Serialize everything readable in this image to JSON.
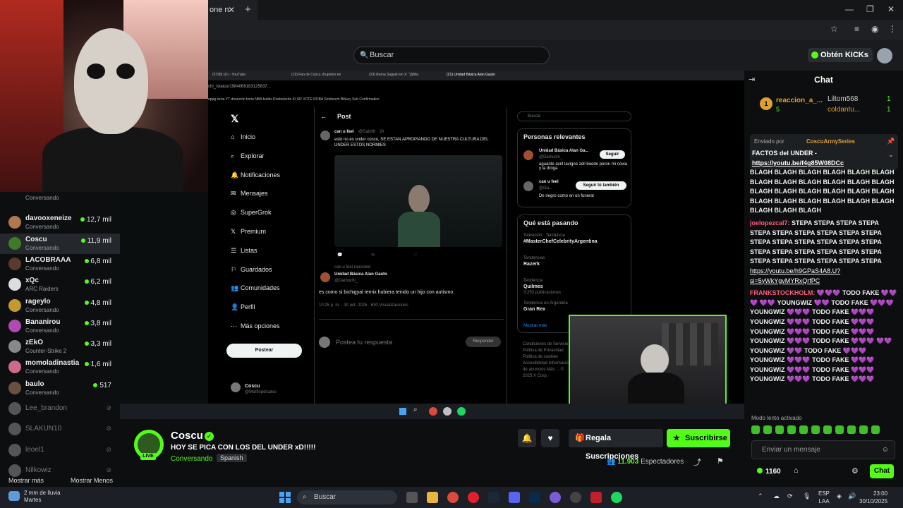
{
  "browser": {
    "tab_label": "one n",
    "close_glyph": "✕",
    "new_tab_glyph": "+"
  },
  "kick_header": {
    "search_placeholder": "Buscar",
    "kicks_button": "Obtén KICKs"
  },
  "sidebar": {
    "items": [
      {
        "name": "",
        "sub": "Conversando",
        "count": "",
        "live": false
      },
      {
        "name": "davooxeneize",
        "sub": "Conversando",
        "count": "12,7 mil",
        "live": true,
        "color": "#b07850"
      },
      {
        "name": "Coscu",
        "sub": "Conversando",
        "count": "11,9 mil",
        "live": true,
        "color": "#3f7a2a",
        "active": true
      },
      {
        "name": "LACOBRAAA",
        "sub": "Conversando",
        "count": "6,8 mil",
        "live": true,
        "color": "#5a3a2a"
      },
      {
        "name": "xQc",
        "sub": "ARC Raiders",
        "count": "6,2 mil",
        "live": true,
        "color": "#ddd"
      },
      {
        "name": "rageylo",
        "sub": "Conversando",
        "count": "4,8 mil",
        "live": true,
        "color": "#c49a30"
      },
      {
        "name": "Bananirou",
        "sub": "Conversando",
        "count": "3,8 mil",
        "live": true,
        "color": "#b04ab0"
      },
      {
        "name": "zEkO",
        "sub": "Counter-Strike 2",
        "count": "3,3 mil",
        "live": true,
        "color": "#888"
      },
      {
        "name": "momoladinastia",
        "sub": "Conversando",
        "count": "1,6 mil",
        "live": true,
        "color": "#d06a8a"
      },
      {
        "name": "baulo",
        "sub": "Conversando",
        "count": "517",
        "live": true,
        "color": "#6a5040"
      },
      {
        "name": "Lee_brandon",
        "sub": "",
        "count": "",
        "live": false,
        "color": "#555"
      },
      {
        "name": "SLAKUN10",
        "sub": "",
        "count": "",
        "live": false,
        "color": "#555"
      },
      {
        "name": "leoel1",
        "sub": "",
        "count": "",
        "live": false,
        "color": "#555"
      },
      {
        "name": "Nilkowiz",
        "sub": "",
        "count": "",
        "live": false,
        "color": "#555"
      }
    ],
    "more": "Mostrar más",
    "less": "Mostrar Menos"
  },
  "inner_browser": {
    "tabs": [
      "(5798) tZo - YouTube",
      "(19) Fan de Coscu chupeton en",
      "(19) Rama Sagasti en X: \"@Ma",
      "(21) Unidad Básica Alan Gauto"
    ],
    "url": "chi_/status/1984069183125837...",
    "bookmarks": "oppg keria   YT   donación   koria   NBA   builds   Roobeterdo   KI   SR   VOTE   ROBA   Solobocm   Bitlucy   Sub Confirmation"
  },
  "twitter": {
    "nav": [
      "Inicio",
      "Explorar",
      "Notificaciones",
      "Mensajes",
      "SuperGrok",
      "Premium",
      "Listas",
      "Guardados",
      "Comunidades",
      "Perfil",
      "Más opciones"
    ],
    "post_button": "Postear",
    "header": "Post",
    "tweet1": {
      "name": "can u feel",
      "handle": "@Gabrifr · 2h",
      "text": "esto no es under coscu, SE ESTAN APROPIANDO DE NUESTRA CULTURA DEL UNDER ESTOS NORMIES"
    },
    "tweet2": {
      "repost": "can u feel reposteó",
      "name": "Unidad Básica Alan Gauto",
      "handle": "@Damuchi_",
      "text": "es como si bichigyal remix hubiera tenido un hijo con autismo",
      "meta": "10:25 p. m. · 30 oct. 2025 · 630 Visualizaciones"
    },
    "reply_placeholder": "Postea tu respuesta",
    "reply_button": "Responder",
    "account_name": "Coscu",
    "account_handle": "@Martinpdisalvo",
    "search": "Buscar",
    "relevant_title": "Personas relevantes",
    "relevant": [
      {
        "name": "Unidad Básica Alan Ga...",
        "handle": "@Damuchi_",
        "bio": "aguante avril lavigne zell boedo peron mi novia y la droga",
        "btn": "Seguir"
      },
      {
        "name": "can u feel",
        "handle": "@Ga...",
        "bio": "De negro como en un funeral",
        "btn": "Seguir tú también"
      }
    ],
    "trends_title": "Qué está pasando",
    "trends": [
      {
        "ctx": "Televisión · Tendencia",
        "name": "#MasterChefCelebrityArgentina",
        "posts": ""
      },
      {
        "ctx": "Tendencias",
        "name": "Razerk",
        "posts": ""
      },
      {
        "ctx": "Tendencia",
        "name": "Quilmes",
        "posts": "3.253 publicaciones"
      },
      {
        "ctx": "Tendencia en Argentina",
        "name": "Gran Rex",
        "posts": ""
      }
    ],
    "show_more": "Mostrar más",
    "footer": "Condiciones de Servicio  Política de Privacidad  Política de cookies  Accesibilidad  Información de anuncios  Más ...  © 2025 X Corp."
  },
  "stream": {
    "name": "Coscu",
    "title": "HOY SE PICA CON LOS DEL UNDER xD!!!!!",
    "category": "Conversando",
    "language": "Spanish",
    "live": "LIVE",
    "gift_button": "Regala Suscripciones",
    "subscribe_button": "Suscribirse",
    "viewers": "11.903",
    "viewers_label": "Espectadores"
  },
  "chat": {
    "title": "Chat",
    "leaderboard": [
      {
        "rank": "1",
        "name": "reaccion_a_...",
        "value": "5"
      },
      {
        "name": "Liltom568",
        "value": "1"
      },
      {
        "name": "coldantu...",
        "value": "1"
      }
    ],
    "pinned_by": "Enviado por",
    "pinned_user": "CoscuArmySeries",
    "pinned_text": "FACTOS del UNDER -",
    "pinned_link": "https://youtu.be/f4g85W08DCc",
    "messages": [
      {
        "user": "",
        "color": "#fff",
        "text": "BLAGH BLAGH BLAGH BLAGH BLAGH BLAGH BLAGH BLAGH BLAGH BLAGH BLAGH BLAGH BLAGH BLAGH BLAGH BLAGH BLAGH BLAGH BLAGH BLAGH BLAGH BLAGH BLAGH BLAGH BLAGH BLAGH BLAGH"
      },
      {
        "user": "joelopezcal7:",
        "color": "#ff5c7a",
        "text": "STEPA STEPA STEPA STEPA STEPA STEPA STEPA STEPA STEPA STEPA STEPA STEPA STEPA STEPA STEPA STEPA STEPA STEPA STEPA STEPA STEPA STEPA STEPA STEPA STEPA STEPA STEPA STEPA",
        "link": "https://youtu.be/h9GPaS4A8.U?si=5yWkYgvMYRxQrfPC"
      },
      {
        "user": "FRANKSTOCKHOLM:",
        "color": "#ff5c7a",
        "text": "💜💜💜 TODO FAKE 💜💜💜 💜💜 YOUNGWIZ 💜💜 TODO FAKE 💜💜💜 YOUNGWIZ 💜💜💜 TODO FAKE 💜💜💜 YOUNGWIZ 💜💜💜 TODO FAKE 💜💜💜 YOUNGWIZ 💜💜💜 TODO FAKE 💜💜💜 YOUNGWIZ 💜💜💜 TODO FAKE 💜💜💜 💜💜 YOUNGWIZ 💜💜 TODO FAKE 💜💜💜 YOUNGWIZ 💜💜💜 TODO FAKE 💜💜💜 YOUNGWIZ 💜💜💜 TODO FAKE 💜💜💜 YOUNGWIZ 💜💜💜 TODO FAKE 💜💜💜"
      }
    ],
    "slow_mode": "Modo lento activado",
    "input_placeholder": "Enviar un mensaje",
    "kicks": "1160",
    "send": "Chat"
  },
  "taskbar": {
    "weather_temp": "2 mm de lluvia",
    "weather_day": "Martes",
    "search": "Buscar",
    "lang1": "ESP",
    "lang2": "LAA",
    "time": "23:00",
    "date": "30/10/2025"
  }
}
